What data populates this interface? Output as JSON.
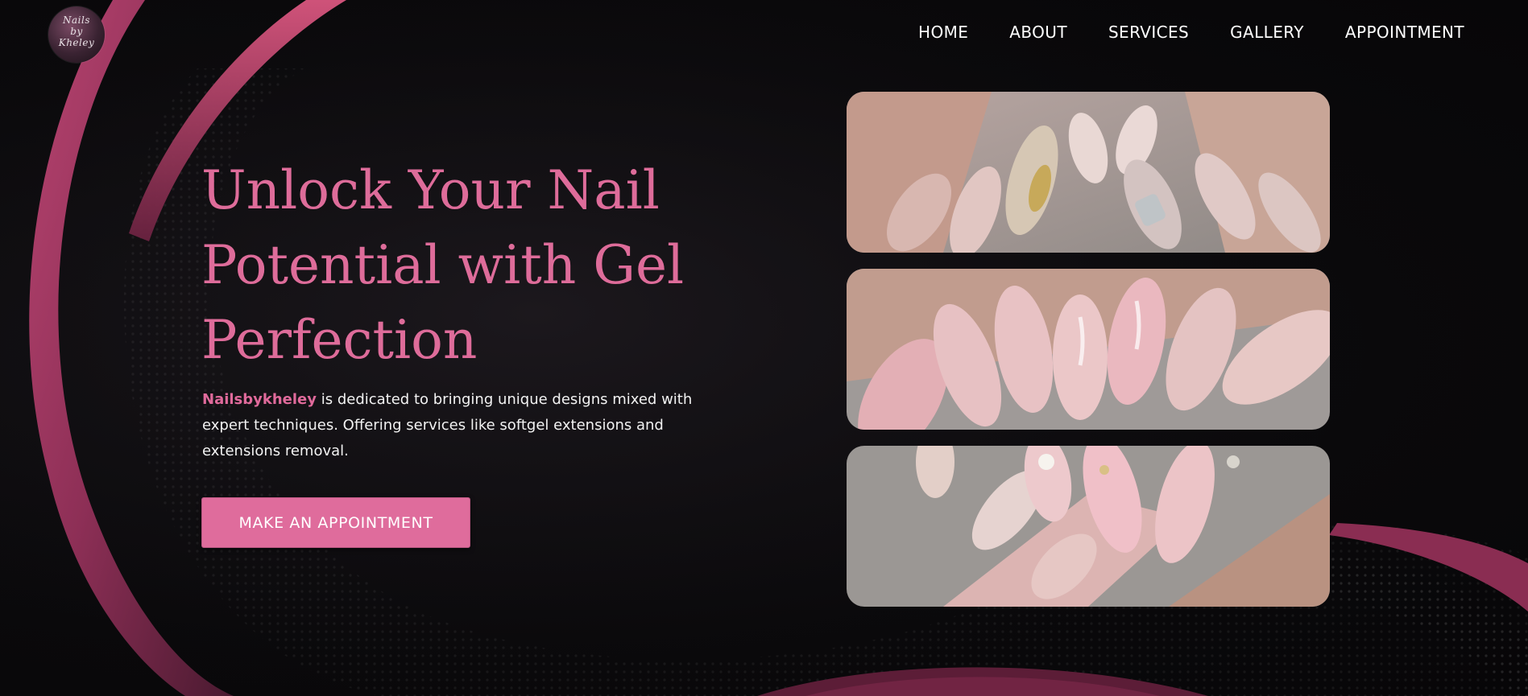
{
  "logo": {
    "alt_text": "Nails by Kheley",
    "icon": "logo-icon"
  },
  "nav": {
    "items": [
      {
        "label": "HOME"
      },
      {
        "label": "ABOUT"
      },
      {
        "label": "SERVICES"
      },
      {
        "label": "GALLERY"
      },
      {
        "label": "APPOINTMENT"
      }
    ]
  },
  "hero": {
    "title": "Unlock Your Nail Potential with Gel Perfection",
    "brand": "Nailsbykheley",
    "description": " is dedicated to bringing unique designs mixed with expert techniques. Offering services like softgel extensions and extensions removal.",
    "cta_label": "MAKE AN APPOINTMENT"
  },
  "gallery": {
    "images": [
      {
        "icon": "nail-art-photo-icon"
      },
      {
        "icon": "nail-art-photo-icon"
      },
      {
        "icon": "nail-art-photo-icon"
      }
    ]
  },
  "colors": {
    "accent": "#de6c9a",
    "background": "#0b0a0c",
    "text": "#ffffff"
  }
}
